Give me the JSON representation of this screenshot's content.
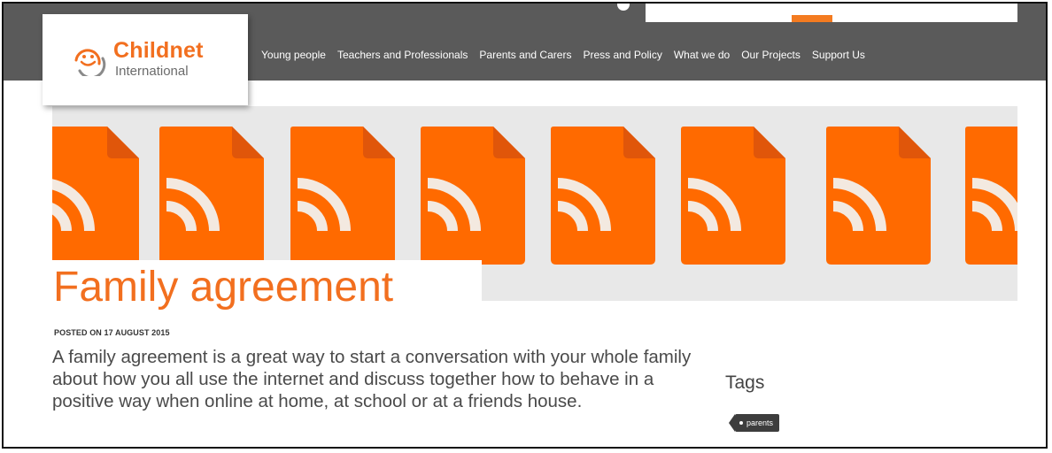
{
  "brand": {
    "name": "Childnet",
    "subtitle": "International",
    "accent_color": "#f26f1f",
    "header_color": "#5a5a5a"
  },
  "nav": {
    "items": [
      {
        "label": "Young people"
      },
      {
        "label": "Teachers and Professionals"
      },
      {
        "label": "Parents and Carers"
      },
      {
        "label": "Press and Policy"
      },
      {
        "label": "What we do"
      },
      {
        "label": "Our Projects"
      },
      {
        "label": "Support Us"
      }
    ]
  },
  "hero": {
    "icon": "rss-feed-icon",
    "tile_color": "#ff6a00"
  },
  "article": {
    "title": "Family agreement",
    "posted": "POSTED ON 17 AUGUST 2015",
    "lead": "A family agreement is a great way to start a conversation with your whole family about how you all use the internet and discuss together how to behave in a positive way when online at home, at school or at a friends house."
  },
  "sidebar": {
    "tags_heading": "Tags",
    "tags": [
      {
        "label": "parents"
      }
    ]
  }
}
